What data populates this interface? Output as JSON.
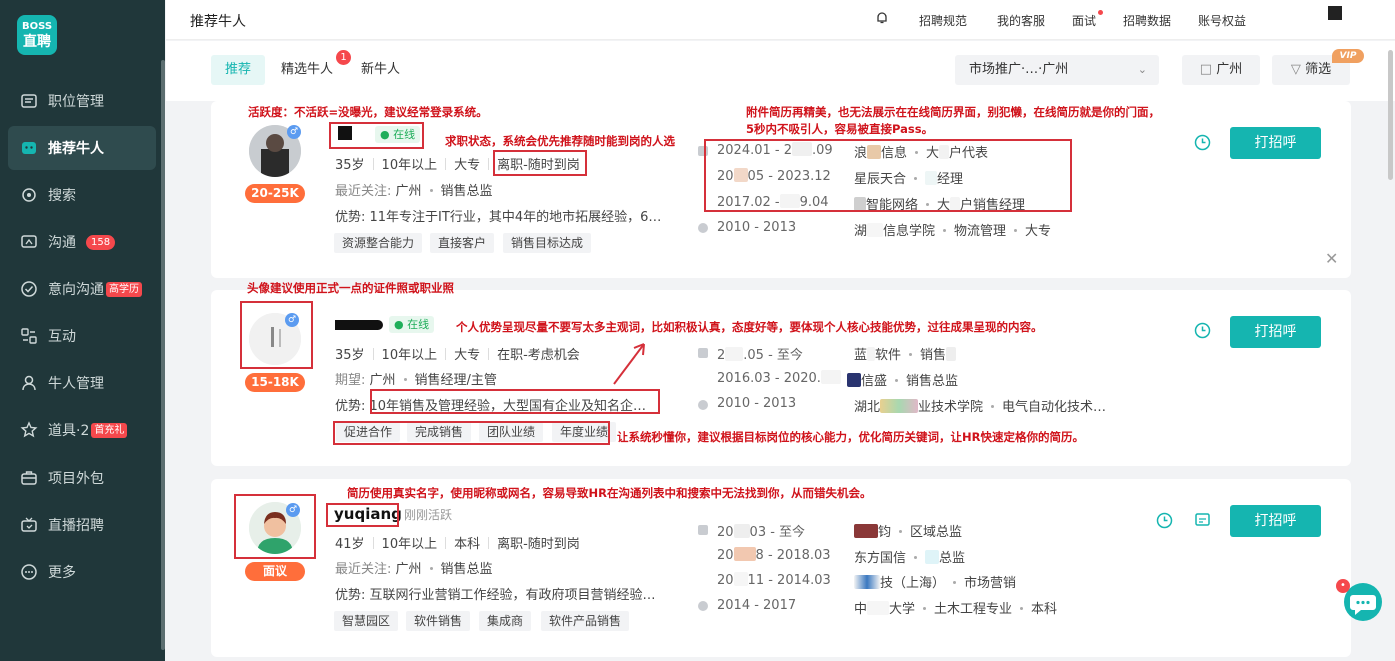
{
  "logo": {
    "line1": "BOSS",
    "line2": "直聘"
  },
  "sidebar": {
    "items": [
      {
        "label": "职位管理",
        "icon": "post-icon"
      },
      {
        "label": "推荐牛人",
        "icon": "recommend-icon",
        "active": true
      },
      {
        "label": "搜索",
        "icon": "search-icon"
      },
      {
        "label": "沟通",
        "icon": "chat-icon",
        "badge": "158"
      },
      {
        "label": "意向沟通",
        "icon": "intent-icon",
        "tag": "高学历"
      },
      {
        "label": "互动",
        "icon": "interact-icon"
      },
      {
        "label": "牛人管理",
        "icon": "person-icon"
      },
      {
        "label": "道具·2",
        "icon": "gift-icon",
        "tag": "首充礼"
      },
      {
        "label": "项目外包",
        "icon": "briefcase-icon"
      },
      {
        "label": "直播招聘",
        "icon": "live-icon"
      },
      {
        "label": "更多",
        "icon": "more-icon"
      }
    ]
  },
  "header": {
    "title": "推荐牛人",
    "links": [
      "招聘规范",
      "我的客服",
      "面试",
      "招聘数据",
      "账号权益"
    ]
  },
  "tabs": {
    "items": [
      "推荐",
      "精选牛人",
      "新牛人"
    ],
    "badge": "1",
    "job_select": "市场推广·…·广州",
    "city": "广州",
    "filter": "筛选",
    "vip": "VIP"
  },
  "candidates": [
    {
      "name": "",
      "status": "在线",
      "salary": "20-25K",
      "age": "35岁",
      "years": "10年以上",
      "edu": "大专",
      "state": "离职-随时到岗",
      "focus_label": "最近关注:",
      "focus_city": "广州",
      "focus_job": "销售总监",
      "adv": "优势: 11年专注于IT行业，其中4年的地市拓展经验，6…",
      "tags": [
        "资源整合能力",
        "直接客户",
        "销售目标达成"
      ],
      "exp": [
        {
          "date": "2024.01 - 2",
          "date2": ".09",
          "company": "浪",
          "company2": "信息",
          "role": "大",
          "role2": "户代表"
        },
        {
          "date": "20",
          "date2": "05 - 2023.12",
          "company": "星辰天合",
          "company2": "",
          "role": "",
          "role2": "经理"
        },
        {
          "date": "2017.02 -",
          "date2": "9.04",
          "company": "",
          "company2": "智能网络",
          "role": "大",
          "role2": "户销售经理"
        }
      ],
      "edu_row": {
        "date": "2010 - 2013",
        "school": "湖",
        "school2": "信息学院",
        "major": "物流管理",
        "degree": "大专"
      },
      "call": "打招呼"
    },
    {
      "name": "",
      "status": "在线",
      "salary": "15-18K",
      "age": "35岁",
      "years": "10年以上",
      "edu": "大专",
      "state": "在职-考虑机会",
      "focus_label": "期望:",
      "focus_city": "广州",
      "focus_job": "销售经理/主管",
      "adv": "优势: 10年销售及管理经验，大型国有企业及知名企…",
      "tags": [
        "促进合作",
        "完成销售",
        "团队业绩",
        "年度业绩"
      ],
      "exp": [
        {
          "date": "2",
          "date2": ".05 - 至今",
          "company": "蓝",
          "company2": "软件",
          "role": "销售",
          "role2": ""
        },
        {
          "date": "2016.03 - 2020.",
          "date2": "",
          "company": "",
          "company2": "信盛",
          "role": "销售总监",
          "role2": ""
        }
      ],
      "edu_row": {
        "date": "2010 - 2013",
        "school": "湖北",
        "school2": "业技术学院",
        "major": "电气自动化技术…",
        "degree": ""
      },
      "call": "打招呼"
    },
    {
      "name": "yuqiang",
      "status": "刚刚活跃",
      "salary": "面议",
      "age": "41岁",
      "years": "10年以上",
      "edu": "本科",
      "state": "离职-随时到岗",
      "focus_label": "最近关注:",
      "focus_city": "广州",
      "focus_job": "销售总监",
      "adv": "优势: 互联网行业营销工作经验，有政府项目营销经验…",
      "tags": [
        "智慧园区",
        "软件销售",
        "集成商",
        "软件产品销售"
      ],
      "exp": [
        {
          "date": "20",
          "date2": "03 - 至今",
          "company": "",
          "company2": "钧",
          "role": "区域总监",
          "role2": ""
        },
        {
          "date": "20",
          "date2": "8 - 2018.03",
          "company": "东方国信",
          "company2": "",
          "role": "",
          "role2": "总监"
        },
        {
          "date": "20",
          "date2": "11 - 2014.03",
          "company": "",
          "company2": "技（上海）",
          "role": "市场营销",
          "role2": ""
        }
      ],
      "edu_row": {
        "date": "2014 - 2017",
        "school": "中",
        "school2": "大学",
        "major": "土木工程专业",
        "degree": "本科"
      },
      "call": "打招呼"
    }
  ],
  "annotations": [
    "活跃度：不活跃=没曝光，建议经常登录系统。",
    "求职状态，系统会优先推荐随时能到岗的人选",
    "附件简历再精美，也无法展示在在线简历界面，别犯懒，在线简历就是你的门面，",
    "5秒内不吸引人，容易被直接Pass。",
    "头像建议使用正式一点的证件照或职业照",
    "个人优势呈现尽量不要写太多主观词，比如积极认真，态度好等，要体现个人核心技能优势，过往成果呈现的内容。",
    "让系统秒懂你，建议根据目标岗位的核心能力，优化简历关键词，让HR快速定格你的简历。",
    "简历使用真实名字，使用昵称或网名，容易导致HR在沟通列表中和搜索中无法找到你，从而错失机会。"
  ],
  "colors": {
    "accent": "#15b5b0",
    "sidebar": "#20373a",
    "annotation": "#d0131b",
    "salary": "#ff6e3b"
  }
}
